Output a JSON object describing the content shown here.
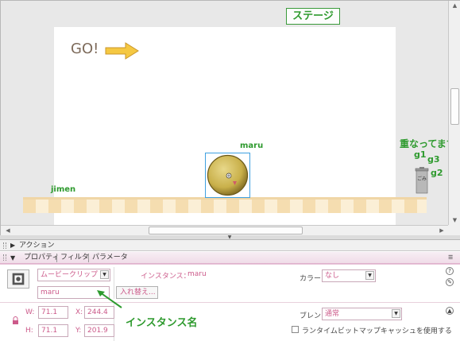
{
  "stage": {
    "label": "ステージ",
    "go_text": "GO!",
    "labels": {
      "maru": "maru",
      "jimen": "jimen",
      "overlap": "重なってます",
      "g1": "g1",
      "g2": "g2",
      "g3": "g3"
    },
    "trash_text": "ごみ",
    "colors": {
      "label_green": "#2e9a2e",
      "arrow_yellow": "#f5c842",
      "ball_gold": "#c9b04a",
      "selection_blue": "#3fa0e0"
    }
  },
  "actions_panel": {
    "title": "アクション"
  },
  "properties_panel": {
    "tabs": [
      "プロパティ",
      "フィルタ",
      "パラメータ"
    ],
    "symbol_type": "ムービークリップ",
    "instance_label": "インスタンス：",
    "instance_value": "maru",
    "instance_name": "maru",
    "swap_button": "入れ替え...",
    "w_label": "W:",
    "w_value": "71.1",
    "h_label": "H:",
    "h_value": "71.1",
    "x_label": "X:",
    "x_value": "244.4",
    "y_label": "Y:",
    "y_value": "201.9",
    "color_label": "カラー：",
    "color_value": "なし",
    "blend_label": "ブレンド：",
    "blend_value": "通常",
    "cache_label": "ランタイムビットマップキャッシュを使用する",
    "cache_checked": false
  },
  "annotations": {
    "instance_name_note": "インスタンス名"
  }
}
